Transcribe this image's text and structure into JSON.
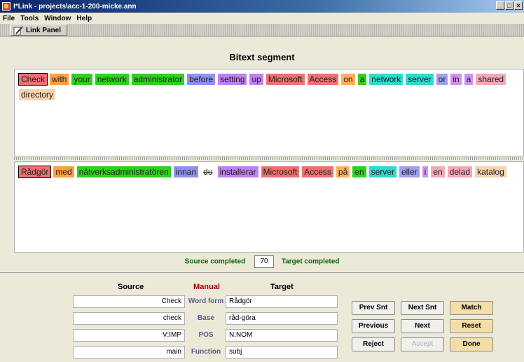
{
  "window": {
    "title": "I*Link - projects\\acc-1-200-micke.ann"
  },
  "menu": [
    "File",
    "Tools",
    "Window",
    "Help"
  ],
  "tab": {
    "label": "Link Panel"
  },
  "panel": {
    "heading": "Bitext segment"
  },
  "source_words": [
    {
      "text": "Check",
      "color": "#f07070",
      "selected": true
    },
    {
      "text": "with",
      "color": "#ffa040"
    },
    {
      "text": "your",
      "color": "#30d020"
    },
    {
      "text": "network",
      "color": "#30d020"
    },
    {
      "text": "administrator",
      "color": "#30d020"
    },
    {
      "text": "before",
      "color": "#9090f0"
    },
    {
      "text": "setting",
      "color": "#c080f0"
    },
    {
      "text": "up",
      "color": "#c080f0"
    },
    {
      "text": "Microsoft",
      "color": "#f07070"
    },
    {
      "text": "Access",
      "color": "#f07070"
    },
    {
      "text": "on",
      "color": "#ffb060"
    },
    {
      "text": "a",
      "color": "#30d020"
    },
    {
      "text": "network",
      "color": "#30d8d0"
    },
    {
      "text": "server",
      "color": "#30d8d0"
    },
    {
      "text": "or",
      "color": "#a0a0f0"
    },
    {
      "text": "in",
      "color": "#d090f0"
    },
    {
      "text": "a",
      "color": "#d090f0"
    },
    {
      "text": "shared",
      "color": "#f4a8b8"
    },
    {
      "text": "directory",
      "color": "#f8d4b0"
    }
  ],
  "target_words": [
    {
      "text": "Rådgör",
      "color": "#f07070",
      "selected": true
    },
    {
      "text": "med",
      "color": "#ffa040"
    },
    {
      "text": "nätverksadministratören",
      "color": "#30d020"
    },
    {
      "text": "innan",
      "color": "#9090f0"
    },
    {
      "text": "du",
      "color": "#ffffff",
      "struck": true
    },
    {
      "text": "installerar",
      "color": "#c080f0"
    },
    {
      "text": "Microsoft",
      "color": "#f07070"
    },
    {
      "text": "Access",
      "color": "#f07070"
    },
    {
      "text": "på",
      "color": "#ffb060"
    },
    {
      "text": "en",
      "color": "#30d020"
    },
    {
      "text": "server",
      "color": "#30d8d0"
    },
    {
      "text": "eller",
      "color": "#a0a0f0"
    },
    {
      "text": "i",
      "color": "#d090f0"
    },
    {
      "text": "en",
      "color": "#f4a8b8"
    },
    {
      "text": "delad",
      "color": "#f4a8b8"
    },
    {
      "text": "katalog",
      "color": "#f8d4b0"
    }
  ],
  "status": {
    "source_label": "Source completed",
    "count": "70",
    "target_label": "Target completed"
  },
  "details": {
    "source_header": "Source",
    "manual_header": "Manual",
    "target_header": "Target",
    "rows": [
      {
        "label": "Word form",
        "source": "Check",
        "target": "Rådgör"
      },
      {
        "label": "Base",
        "source": "check",
        "target": "råd-göra"
      },
      {
        "label": "POS",
        "source": "V:IMP",
        "target": "N:NOM"
      },
      {
        "label": "Function",
        "source": "main",
        "target": "subj"
      }
    ]
  },
  "buttons": {
    "prev_snt": "Prev Snt",
    "next_snt": "Next Snt",
    "match": "Match",
    "previous": "Previous",
    "next": "Next",
    "reset": "Reset",
    "reject": "Reject",
    "accept": "Accept",
    "done": "Done"
  }
}
